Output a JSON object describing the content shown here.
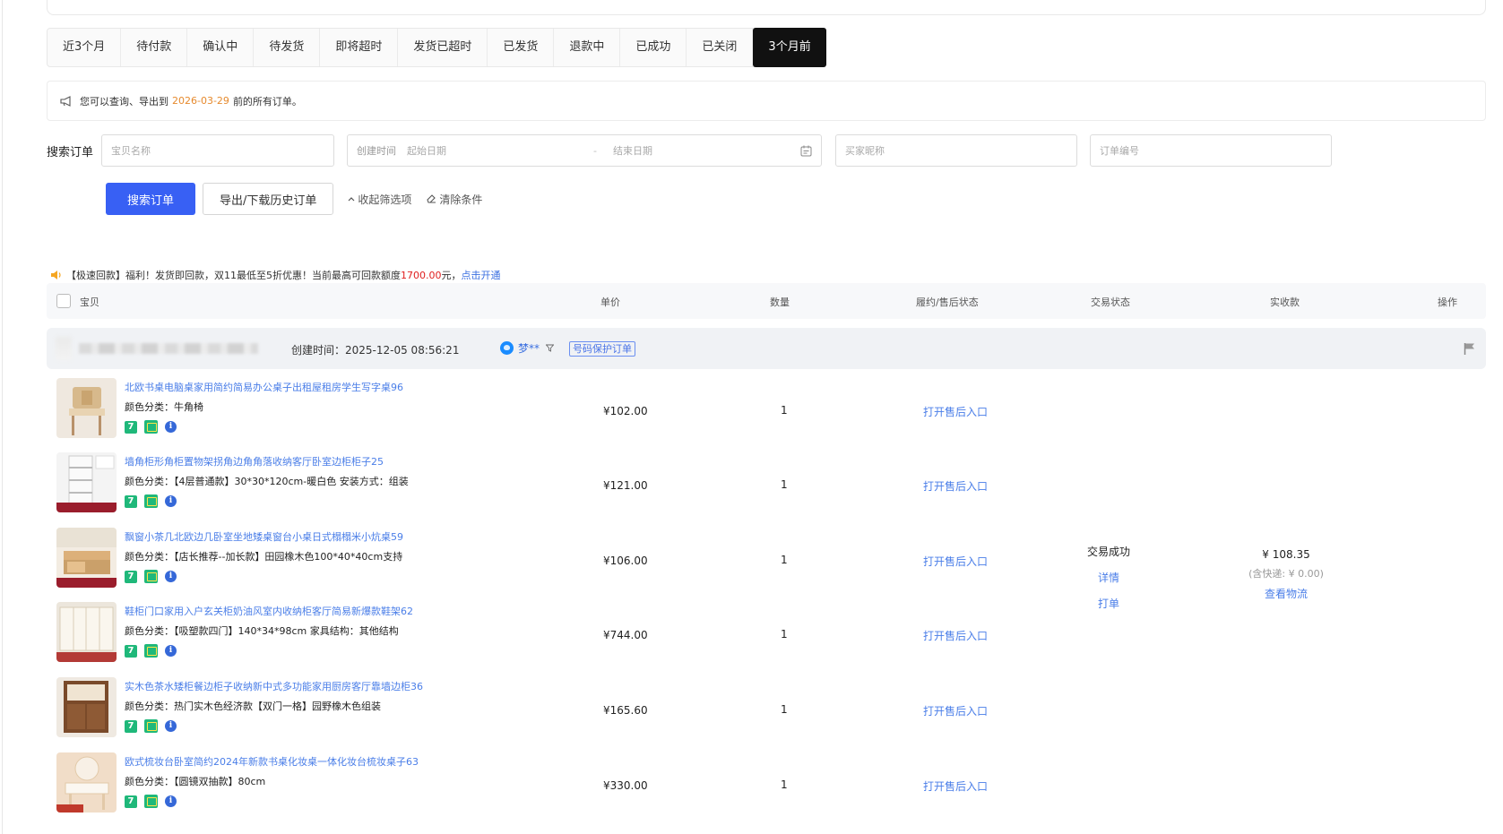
{
  "tabs": [
    {
      "label": "近3个月",
      "active": false
    },
    {
      "label": "待付款",
      "active": false
    },
    {
      "label": "确认中",
      "active": false
    },
    {
      "label": "待发货",
      "active": false
    },
    {
      "label": "即将超时",
      "active": false
    },
    {
      "label": "发货已超时",
      "active": false
    },
    {
      "label": "已发货",
      "active": false
    },
    {
      "label": "退款中",
      "active": false
    },
    {
      "label": "已成功",
      "active": false
    },
    {
      "label": "已关闭",
      "active": false
    },
    {
      "label": "3个月前",
      "active": true
    }
  ],
  "notice": {
    "prefix": "您可以查询、导出到",
    "date": "2026-03-29",
    "suffix": "前的所有订单。"
  },
  "search": {
    "label": "搜索订单",
    "item_name_placeholder": "宝贝名称",
    "create_time_label": "创建时间",
    "start_date_placeholder": "起始日期",
    "date_separator": "-",
    "end_date_placeholder": "结束日期",
    "buyer_placeholder": "买家昵称",
    "order_no_placeholder": "订单编号"
  },
  "actions": {
    "search_button": "搜索订单",
    "export_button": "导出/下载历史订单",
    "collapse_link": "收起筛选项",
    "clear_link": "清除条件"
  },
  "promo": {
    "text_before": "【极速回款】福利！发货即回款，双11最低至5折优惠！当前最高可回款额度",
    "amount": "1700.00",
    "text_after": "元，",
    "link": "点击开通"
  },
  "table_headers": {
    "item": "宝贝",
    "unit_price": "单价",
    "quantity": "数量",
    "fulfillment": "履约/售后状态",
    "trade_status": "交易状态",
    "received": "实收款",
    "action": "操作"
  },
  "order": {
    "create_time": "创建时间：2025-12-05 08:56:21",
    "buyer": "梦**",
    "protect_tag": "号码保护订单",
    "trade_status": "交易成功",
    "detail_link": "详情",
    "print_link": "打单",
    "received_amount": "¥ 108.35",
    "shipping_note": "(含快递: ¥ 0.00)",
    "logistics_link": "查看物流",
    "items": [
      {
        "title": "北欧书桌电脑桌家用简约简易办公桌子出租屋租房学生写字桌96",
        "sku": "颜色分类：牛角椅",
        "price": "¥102.00",
        "qty": "1",
        "aftersale": "打开售后入口"
      },
      {
        "title": "墙角柜形角柜置物架拐角边角角落收纳客厅卧室边柜柜子25",
        "sku": "颜色分类：【4层普通款】30*30*120cm-暖白色  安装方式：组装",
        "price": "¥121.00",
        "qty": "1",
        "aftersale": "打开售后入口"
      },
      {
        "title": "飘窗小茶几北欧边几卧室坐地矮桌窗台小桌日式榻榻米小炕桌59",
        "sku": "颜色分类：【店长推荐--加长款】田园橡木色100*40*40cm支持",
        "price": "¥106.00",
        "qty": "1",
        "aftersale": "打开售后入口"
      },
      {
        "title": "鞋柜门口家用入户玄关柜奶油风室内收纳柜客厅简易新爆款鞋架62",
        "sku": "颜色分类：【吸塑款四门】140*34*98cm  家具结构：其他结构",
        "price": "¥744.00",
        "qty": "1",
        "aftersale": "打开售后入口"
      },
      {
        "title": "实木色茶水矮柜餐边柜子收纳新中式多功能家用厨房客厅靠墙边柜36",
        "sku": "颜色分类：热门实木色经济款【双门一格】园野橡木色组装",
        "price": "¥165.60",
        "qty": "1",
        "aftersale": "打开售后入口"
      },
      {
        "title": "欧式梳妆台卧室简约2024年新款书桌化妆桌一体化妆台梳妆桌子63",
        "sku": "颜色分类：【圆镜双抽款】80cm",
        "price": "¥330.00",
        "qty": "1",
        "aftersale": "打开售后入口"
      }
    ]
  },
  "colors": {
    "primary": "#3860f4",
    "link": "#4a7ee8",
    "notice_date": "#e68a2e",
    "promo_amount": "#e02020",
    "badge_green": "#1fb87a",
    "active_tab": "#111111"
  }
}
